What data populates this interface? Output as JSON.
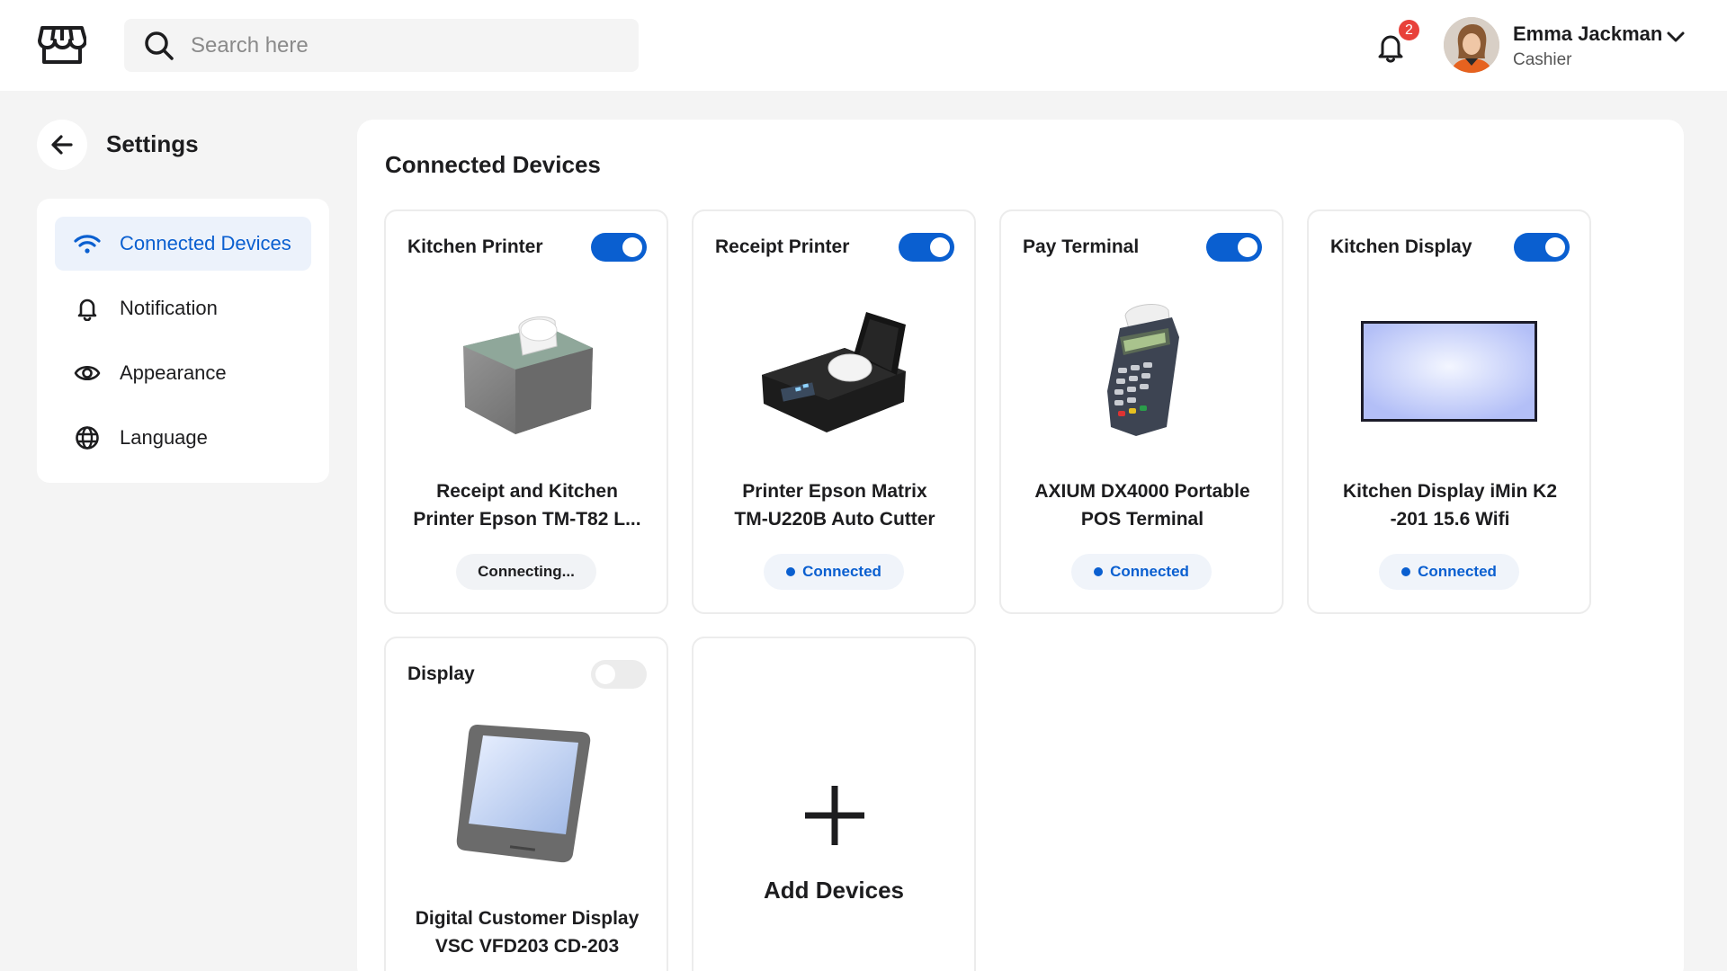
{
  "header": {
    "search_placeholder": "Search here",
    "notification_count": "2",
    "user": {
      "name": "Emma Jackman",
      "role": "Cashier"
    }
  },
  "sidebar": {
    "title": "Settings",
    "items": [
      {
        "label": "Connected Devices",
        "icon": "wifi-icon",
        "active": true
      },
      {
        "label": "Notification",
        "icon": "bell-icon",
        "active": false
      },
      {
        "label": "Appearance",
        "icon": "eye-icon",
        "active": false
      },
      {
        "label": "Language",
        "icon": "globe-icon",
        "active": false
      }
    ]
  },
  "main": {
    "title": "Connected Devices",
    "devices": [
      {
        "category": "Kitchen Printer",
        "name_line1": "Receipt and Kitchen",
        "name_line2": "Printer Epson TM-T82 L...",
        "status": "Connecting...",
        "enabled": true
      },
      {
        "category": "Receipt Printer",
        "name_line1": "Printer Epson Matrix",
        "name_line2": "TM-U220B Auto Cutter",
        "status": "Connected",
        "enabled": true
      },
      {
        "category": "Pay Terminal",
        "name_line1": "AXIUM DX4000 Portable",
        "name_line2": "POS Terminal",
        "status": "Connected",
        "enabled": true
      },
      {
        "category": "Kitchen Display",
        "name_line1": "Kitchen Display iMin K2",
        "name_line2": "-201 15.6 Wifi",
        "status": "Connected",
        "enabled": true
      },
      {
        "category": "Display",
        "name_line1": "Digital Customer Display",
        "name_line2": "VSC VFD203 CD-203",
        "enabled": false
      }
    ],
    "add_label": "Add Devices"
  },
  "colors": {
    "accent": "#0a5fd0",
    "badge": "#e8413a",
    "background": "#f4f4f4"
  }
}
